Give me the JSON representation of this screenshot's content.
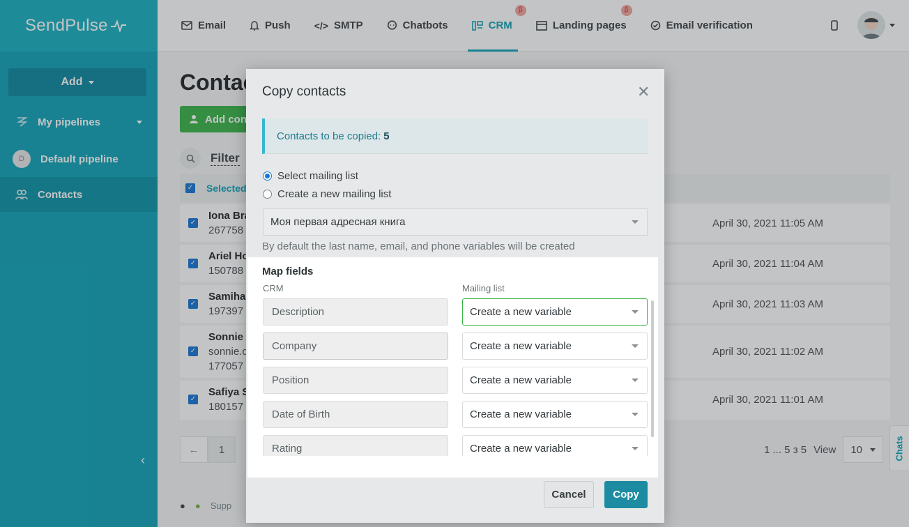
{
  "app": {
    "logo": "SendPulse"
  },
  "nav": {
    "items": [
      {
        "label": "Email",
        "icon": "envelope-icon"
      },
      {
        "label": "Push",
        "icon": "bell-icon"
      },
      {
        "label": "SMTP",
        "icon": "code-icon"
      },
      {
        "label": "Chatbots",
        "icon": "chat-icon"
      },
      {
        "label": "CRM",
        "icon": "crm-icon",
        "active": true,
        "beta": "β"
      },
      {
        "label": "Landing pages",
        "icon": "landing-icon",
        "beta": "β"
      },
      {
        "label": "Email verification",
        "icon": "check-circle-icon"
      }
    ]
  },
  "sidebar": {
    "add_label": "Add",
    "items": [
      {
        "label": "My pipelines",
        "icon": "pipeline-icon"
      },
      {
        "label": "Default pipeline",
        "badge": "D"
      },
      {
        "label": "Contacts",
        "icon": "contacts-icon",
        "active": true
      }
    ],
    "support_text": "Supp"
  },
  "main": {
    "title": "Contac",
    "add_contact_label": "Add cont",
    "filter_label": "Filter",
    "selected_label": "Selected",
    "rows": [
      {
        "name": "Iona Bra",
        "sub": "267758",
        "date": "April 30, 2021 11:05 AM"
      },
      {
        "name": "Ariel Ho",
        "sub": "150788",
        "date": "April 30, 2021 11:04 AM"
      },
      {
        "name": "Samiha",
        "sub": "197397",
        "date": "April 30, 2021 11:03 AM"
      },
      {
        "name": "Sonnie (",
        "sub": "sonnie.o",
        "sub2": "177057",
        "date": "April 30, 2021 11:02 AM"
      },
      {
        "name": "Safiya S",
        "sub": "180157",
        "date": "April 30, 2021 11:01 AM"
      }
    ],
    "pager": {
      "prev": "←",
      "current": "1",
      "summary": "1 ... 5 з 5",
      "view_label": "View",
      "view_value": "10"
    },
    "chats_label": "Chats"
  },
  "modal": {
    "title": "Copy contacts",
    "info_text": "Contacts to be copied:",
    "info_count": "5",
    "radio_select": "Select mailing list",
    "radio_create": "Create a new mailing list",
    "list_value": "Моя первая адресная книга",
    "hint": "By default the last name, email, and phone variables will be created",
    "map_title": "Map fields",
    "col_crm": "CRM",
    "col_list": "Mailing list",
    "fields": [
      {
        "crm": "Description",
        "target": "Create a new variable"
      },
      {
        "crm": "Company",
        "target": "Create a new variable"
      },
      {
        "crm": "Position",
        "target": "Create a new variable"
      },
      {
        "crm": "Date of Birth",
        "target": "Create a new variable"
      },
      {
        "crm": "Rating",
        "target": "Create a new variable"
      }
    ],
    "cancel_label": "Cancel",
    "copy_label": "Copy"
  },
  "colors": {
    "accent": "#12a4b9",
    "green": "#3bb54a",
    "copy": "#1d8ca2"
  }
}
